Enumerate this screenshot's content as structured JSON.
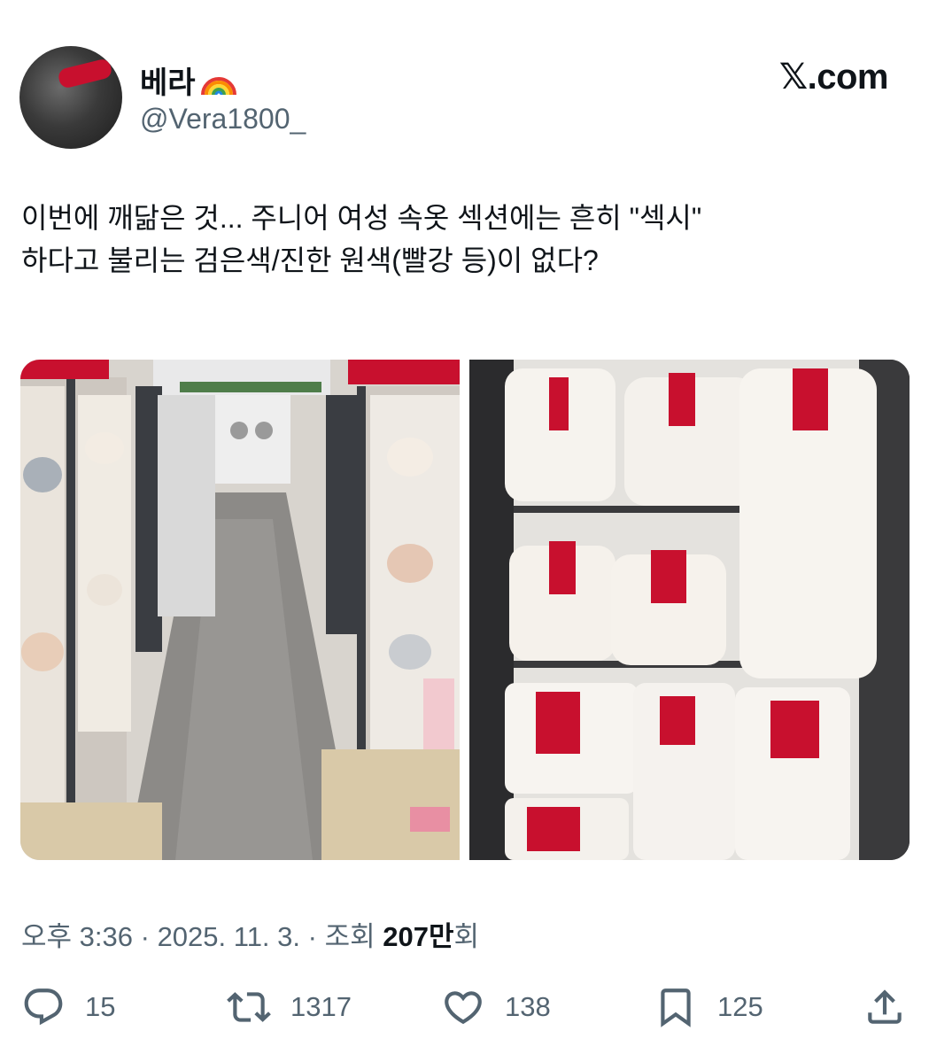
{
  "author": {
    "display_name": "베라",
    "name_emoji_icon": "rainbow-icon",
    "handle": "@Vera1800_"
  },
  "brand": {
    "label": "𝕏.com"
  },
  "tweet": {
    "lines": [
      "이번에 깨닮은 것... 주니어 여성 속옷 섹션에는 흔히 \"섹시\"",
      "하다고 불리는 검은색/진한 원색(빨강 등)이 없다?"
    ]
  },
  "meta": {
    "time": "오후 3:36",
    "separator": " · ",
    "date": "2025. 11. 3.",
    "views_prefix": "조회",
    "views_count": "207만",
    "views_suffix": "회"
  },
  "actions": {
    "reply": {
      "icon": "reply-icon",
      "count": "15"
    },
    "retweet": {
      "icon": "retweet-icon",
      "count": "1317"
    },
    "like": {
      "icon": "heart-icon",
      "count": "138"
    },
    "bookmark": {
      "icon": "bookmark-icon",
      "count": "125"
    },
    "share": {
      "icon": "share-icon"
    }
  },
  "colors": {
    "text_primary": "#0f1419",
    "text_secondary": "#536471",
    "tag_red": "#c8102e"
  }
}
